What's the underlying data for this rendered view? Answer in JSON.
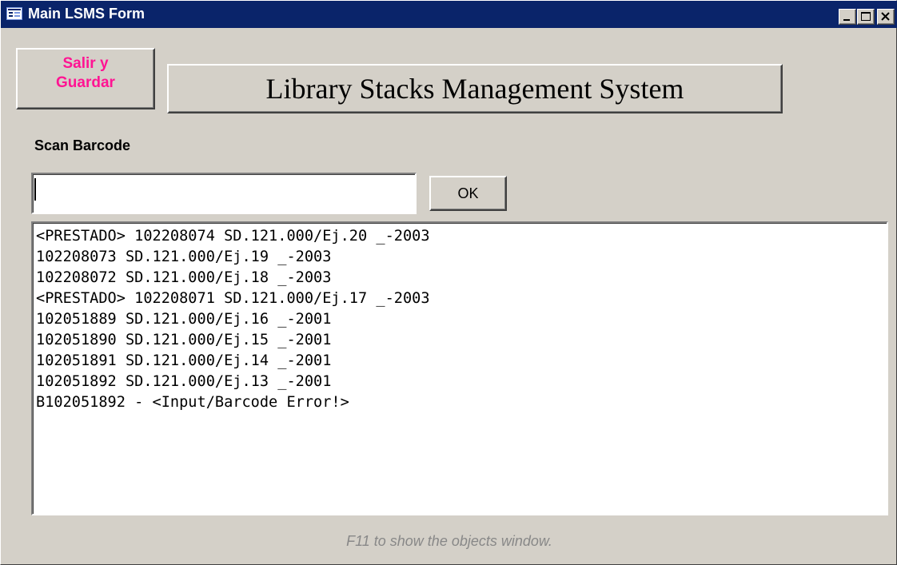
{
  "window": {
    "title": "Main LSMS Form",
    "icon": "form-icon",
    "controls": [
      "minimize-icon",
      "maximize-icon",
      "close-icon"
    ]
  },
  "form": {
    "exit_button_line1": "Salir y",
    "exit_button_line2": "Guardar",
    "banner_title": "Library Stacks Management System",
    "scan_label": "Scan Barcode",
    "barcode_value": "",
    "ok_label": "OK",
    "log_lines": [
      "<PRESTADO> 102208074 SD.121.000/Ej.20 _-2003",
      "102208073 SD.121.000/Ej.19 _-2003",
      "102208072 SD.121.000/Ej.18 _-2003",
      "<PRESTADO> 102208071 SD.121.000/Ej.17 _-2003",
      "102051889 SD.121.000/Ej.16 _-2001",
      "102051890 SD.121.000/Ej.15 _-2001",
      "102051891 SD.121.000/Ej.14 _-2001",
      "102051892 SD.121.000/Ej.13 _-2001",
      "B102051892 - <Input/Barcode Error!>"
    ],
    "hint": "F11 to show the objects window."
  },
  "colors": {
    "titlebar": "#0a246a",
    "face": "#d4d0c8",
    "exit_text": "#ff1493",
    "hint_text": "#888888"
  }
}
